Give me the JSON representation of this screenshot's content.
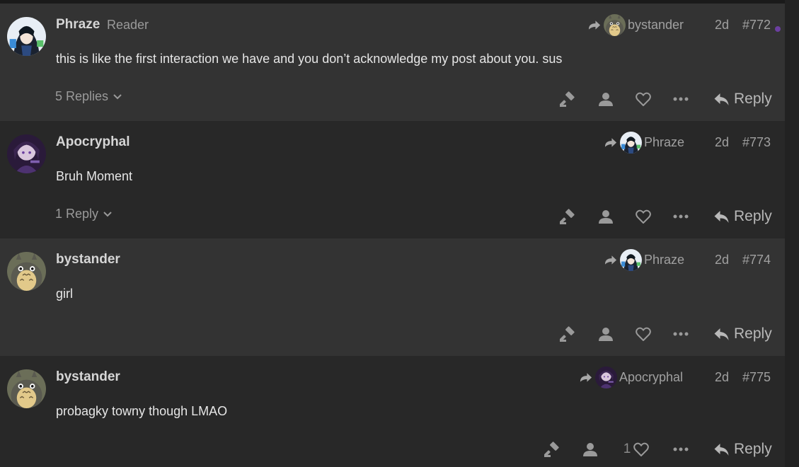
{
  "posts": [
    {
      "author": "Phraze",
      "author_title": "Reader",
      "reply_to": "bystander",
      "time": "2d",
      "post_number": "#772",
      "content": "this is like the first interaction we have and you don’t acknowledge my post about you. sus",
      "replies_label": "5 Replies",
      "reply_label": "Reply",
      "unread": true
    },
    {
      "author": "Apocryphal",
      "author_title": "",
      "reply_to": "Phraze",
      "time": "2d",
      "post_number": "#773",
      "content": "Bruh Moment",
      "replies_label": "1 Reply",
      "reply_label": "Reply"
    },
    {
      "author": "bystander",
      "author_title": "",
      "reply_to": "Phraze",
      "time": "2d",
      "post_number": "#774",
      "content": "girl",
      "replies_label": "",
      "reply_label": "Reply"
    },
    {
      "author": "bystander",
      "author_title": "",
      "reply_to": "Apocryphal",
      "time": "2d",
      "post_number": "#775",
      "content": "probagky towny though LMAO",
      "replies_label": "",
      "like_count": "1",
      "reply_label": "Reply"
    }
  ],
  "icons": {
    "reply_arrow": "share-arrow-icon",
    "admin": "gavel-icon",
    "user": "user-icon",
    "like": "heart-icon",
    "more": "ellipsis-icon",
    "reply": "reply-icon",
    "chevron": "chevron-down-icon"
  },
  "colors": {
    "bg_light": "#333333",
    "bg_dark": "#282828",
    "unread_dot": "#6b3fa0"
  }
}
